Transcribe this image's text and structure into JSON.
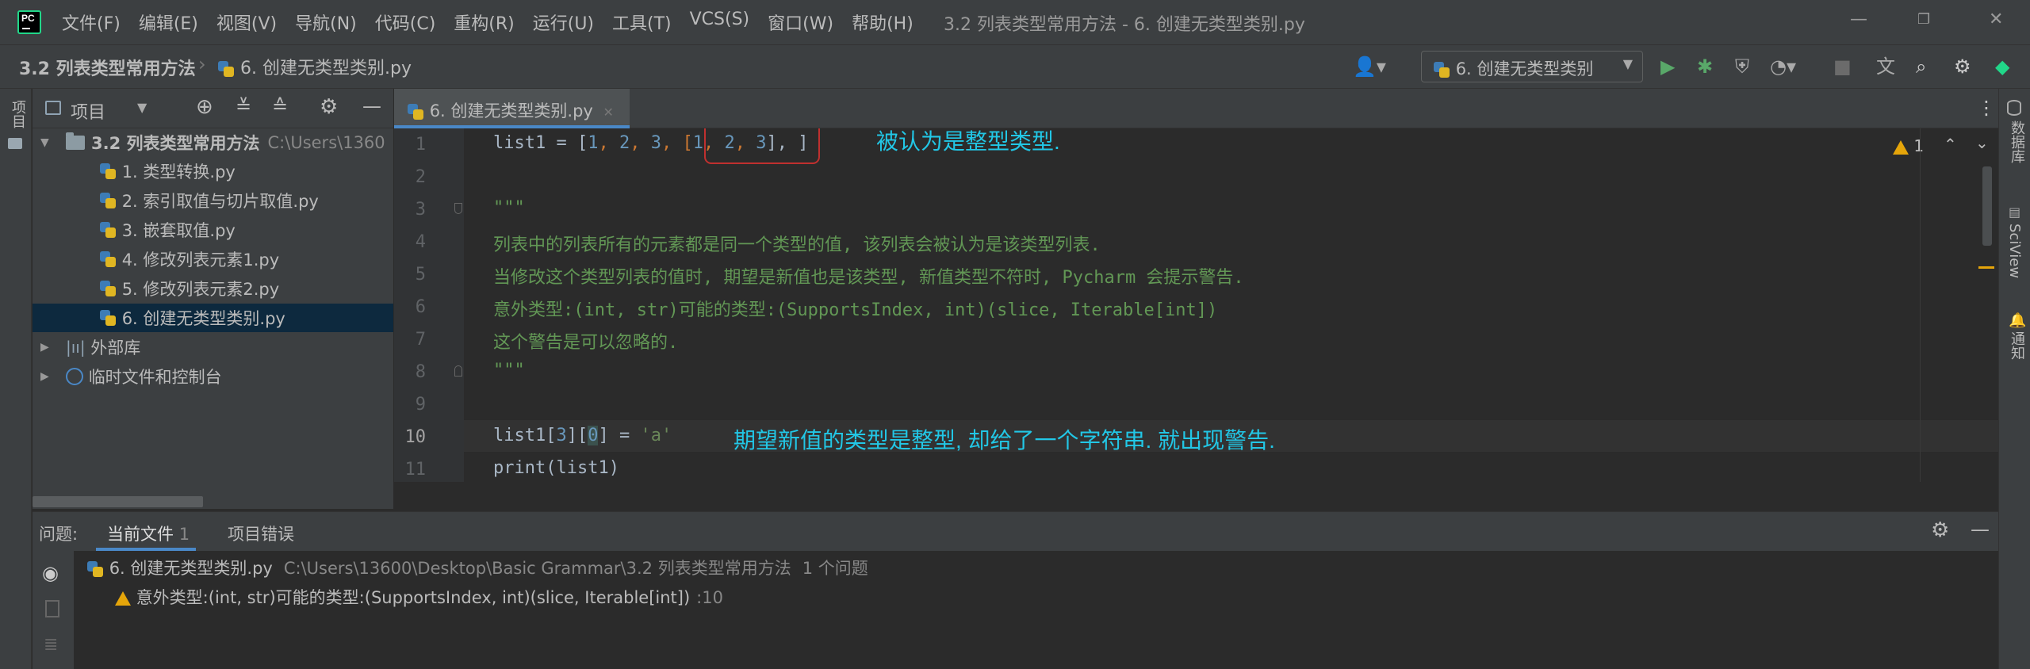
{
  "app": {
    "menu": [
      "文件(F)",
      "编辑(E)",
      "视图(V)",
      "导航(N)",
      "代码(C)",
      "重构(R)",
      "运行(U)",
      "工具(T)",
      "VCS(S)",
      "窗口(W)",
      "帮助(H)"
    ],
    "window_title": "3.2 列表类型常用方法 - 6. 创建无类型类别.py"
  },
  "navbar": {
    "project": "3.2 列表类型常用方法",
    "file": "6. 创建无类型类别.py",
    "run_config": "6. 创建无类型类别"
  },
  "left_strip": {
    "label": "项目"
  },
  "right_strip": {
    "items": [
      "数据库",
      "SciView",
      "通知"
    ]
  },
  "project_panel": {
    "title": "项目",
    "root": {
      "name": "3.2 列表类型常用方法",
      "path": "C:\\Users\\1360"
    },
    "files": [
      "1. 类型转换.py",
      "2. 索引取值与切片取值.py",
      "3. 嵌套取值.py",
      "4. 修改列表元素1.py",
      "5. 修改列表元素2.py",
      "6. 创建无类型类别.py"
    ],
    "ext_lib": "外部库",
    "scratch": "临时文件和控制台"
  },
  "editor": {
    "tab": "6. 创建无类型类别.py",
    "line_numbers": [
      "1",
      "2",
      "3",
      "4",
      "5",
      "6",
      "7",
      "8",
      "9",
      "10",
      "11"
    ],
    "lines": {
      "l1": {
        "a": "list1 = [",
        "n1": "1",
        "c1": ", ",
        "n2": "2",
        "c2": ", ",
        "n3": "3",
        "c3": ", [",
        "n4": "1",
        "c4": ", ",
        "n5": "2",
        "c5": ", ",
        "n6": "3",
        "c6": "], ]"
      },
      "l3": "\"\"\"",
      "l4": "列表中的列表所有的元素都是同一个类型的值, 该列表会被认为是该类型列表.",
      "l5": "当修改这个类型列表的值时, 期望是新值也是该类型, 新值类型不符时, Pycharm 会提示警告.",
      "l6": "意外类型:(int, str)可能的类型:(SupportsIndex, int)(slice, Iterable[int])",
      "l7": "这个警告是可以忽略的.",
      "l8": "\"\"\"",
      "l10": {
        "a": "list1[",
        "n1": "3",
        "b": "][",
        "n2": "0",
        "c": "] = ",
        "s": "'a'"
      },
      "l11": "print(list1)"
    },
    "warning_count": "1",
    "annotation1": "被认为是整型类型.",
    "annotation2": "期望新值的类型是整型, 却给了一个字符串. 就出现警告."
  },
  "problems": {
    "label": "问题:",
    "tabs": [
      {
        "label": "当前文件",
        "count": "1"
      },
      {
        "label": "项目错误"
      }
    ],
    "file": "6. 创建无类型类别.py",
    "path": "C:\\Users\\13600\\Desktop\\Basic Grammar\\3.2 列表类型常用方法",
    "count": "1 个问题",
    "message": "意外类型:(int, str)可能的类型:(SupportsIndex, int)(slice, Iterable[int])",
    "line": ":10"
  },
  "colors": {
    "accent": "#4a88c7",
    "annotation": "#22c7e6",
    "warning": "#e5a50a",
    "selection": "#0d293e"
  }
}
